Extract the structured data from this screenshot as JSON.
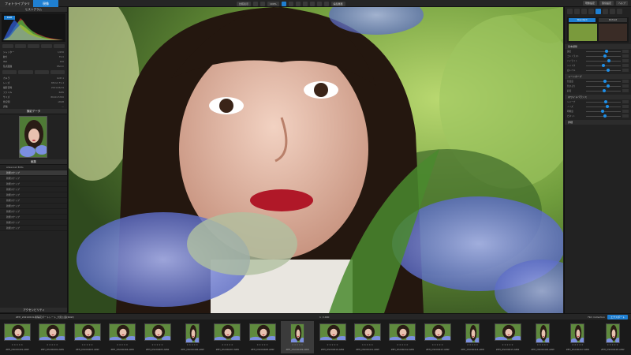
{
  "topbar": {
    "library_tab": "フォトライブラリ",
    "develop_tab": "現像",
    "btn_compare": "比較表示",
    "btn_zoom": "100%",
    "btn_edit": "編集履歴",
    "btn_export": "書き出し",
    "btn_preset": "現像設定",
    "btn_settings": "環境設定",
    "btn_help": "ヘルプ"
  },
  "left_panel": {
    "histogram_title": "ヒストグラム",
    "histogram_badge": "RGB",
    "info_rows": [
      {
        "k": "シャッター",
        "v": "1/250"
      },
      {
        "k": "絞り",
        "v": "F2.0"
      },
      {
        "k": "ISO",
        "v": "100"
      },
      {
        "k": "焦点距離",
        "v": "85mm"
      }
    ],
    "meta_rows": [
      {
        "k": "カメラ",
        "v": "ILCE-1"
      },
      {
        "k": "レンズ",
        "v": "85mm F1.4"
      },
      {
        "k": "撮影日時",
        "v": "2021/06/19"
      },
      {
        "k": "ファイル",
        "v": "RAW"
      },
      {
        "k": "サイズ",
        "v": "8640×5760"
      },
      {
        "k": "色空間",
        "v": "sRGB"
      },
      {
        "k": "評価",
        "v": "—"
      }
    ],
    "thumb_title": "撮影データ",
    "list_title": "編集",
    "list_items": [
      "Advanced Edits",
      "新規スナップ",
      "新規スナップ",
      "新規スナップ",
      "新規スナップ",
      "新規スナップ",
      "新規スナップ",
      "新規スナップ",
      "新規スナップ",
      "新規スナップ",
      "新規スナップ",
      "新規スナップ"
    ],
    "footer": "アクセシビリティ"
  },
  "right_panel": {
    "preset_tabs": [
      "Standard",
      "Portrait"
    ],
    "sections": [
      "基本調整",
      "トーンカーブ",
      "ホワイトバランス",
      "詳細"
    ],
    "sliders_a": [
      "露出",
      "コントラスト",
      "ハイライト",
      "シャドウ",
      "白レベル"
    ],
    "sliders_b": [
      "色温度",
      "色かぶり",
      "彩度"
    ],
    "sliders_c": [
      "シャープ",
      "ノイズ",
      "明瞭度",
      "ビネット"
    ]
  },
  "filmbar": {
    "path": "ZEH_20210619-紫陽花ポートレート_大阪公園(RAW)",
    "count": "1 / 1000",
    "film_collection": "Film Collection",
    "export_button": "エクスポート"
  },
  "filmstrip": {
    "stars": "★★★★★",
    "frames": [
      "ZEH_DSC00401.ARW",
      "ZEH_DSC00402.ARW",
      "ZEH_DSC00403.ARW",
      "ZEH_DSC00404.ARW",
      "ZEH_DSC00405.ARW",
      "ZEH_DSC00406.ARW",
      "ZEH_DSC00407.ARW",
      "ZEH_DSC00408.ARW",
      "ZEH_DSC00409.ARW",
      "ZEH_DSC00410.ARW",
      "ZEH_DSC00411.ARW",
      "ZEH_DSC00412.ARW",
      "ZEH_DSC00413.ARW",
      "ZEH_DSC00414.ARW",
      "ZEH_DSC00415.ARW",
      "ZEH_DSC00416.ARW",
      "ZEH_DSC00417.ARW",
      "ZEH_DSC00418.ARW"
    ]
  },
  "colors": {
    "accent": "#1f7fd1",
    "panel": "#222222",
    "lip": "#b01828",
    "hydrangea": "#7b8fe0"
  }
}
